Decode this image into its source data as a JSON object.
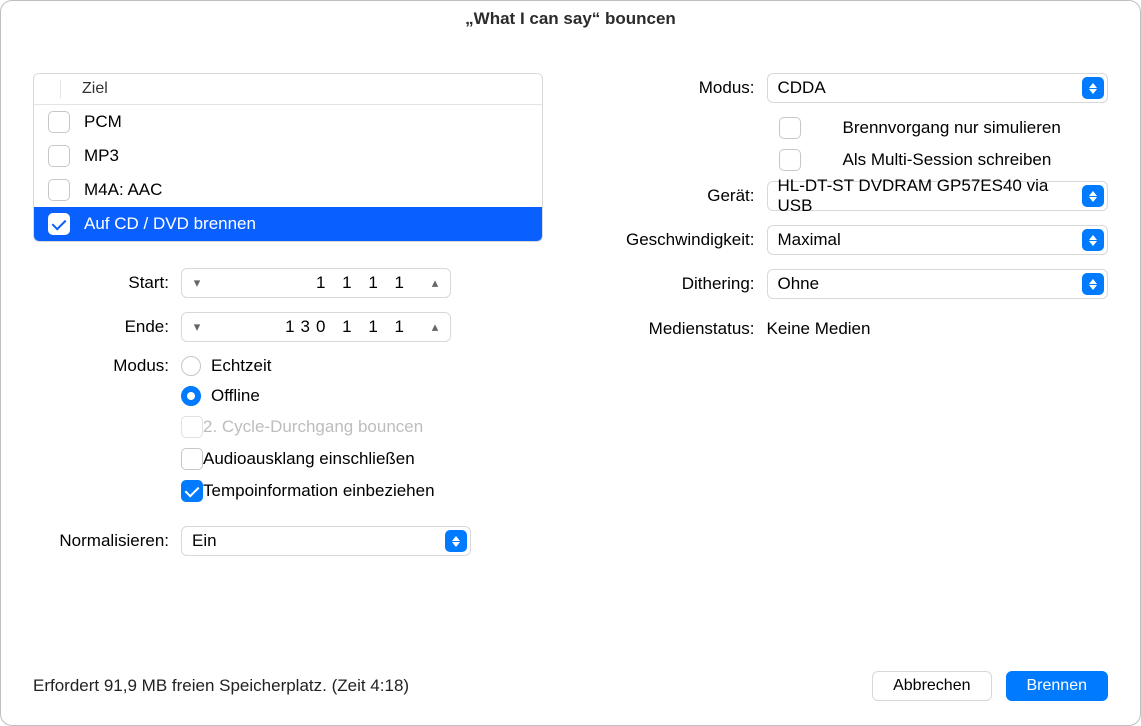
{
  "title": "„What I can say“ bouncen",
  "targets": {
    "header": "Ziel",
    "items": [
      {
        "label": "PCM",
        "checked": false,
        "selected": false
      },
      {
        "label": "MP3",
        "checked": false,
        "selected": false
      },
      {
        "label": "M4A: AAC",
        "checked": false,
        "selected": false
      },
      {
        "label": "Auf CD / DVD brennen",
        "checked": true,
        "selected": true
      }
    ]
  },
  "range": {
    "start_label": "Start:",
    "start_value": "1 1 1   1",
    "end_label": "Ende:",
    "end_value": "130 1 1   1"
  },
  "left_modus": {
    "label": "Modus:",
    "options": {
      "realtime": "Echtzeit",
      "offline": "Offline"
    },
    "selected": "offline",
    "second_cycle": {
      "label": "2. Cycle-Durchgang bouncen",
      "checked": false,
      "disabled": true
    },
    "audio_tail": {
      "label": "Audioausklang einschließen",
      "checked": false
    },
    "tempo_info": {
      "label": "Tempoinformation einbeziehen",
      "checked": true
    }
  },
  "normalize": {
    "label": "Normalisieren:",
    "value": "Ein"
  },
  "right": {
    "modus": {
      "label": "Modus:",
      "value": "CDDA"
    },
    "simulate": {
      "label": "Brennvorgang nur simulieren",
      "checked": false
    },
    "multi": {
      "label": "Als Multi-Session schreiben",
      "checked": false
    },
    "device": {
      "label": "Gerät:",
      "value": "HL-DT-ST DVDRAM GP57ES40 via USB"
    },
    "speed": {
      "label": "Geschwindigkeit:",
      "value": "Maximal"
    },
    "dither": {
      "label": "Dithering:",
      "value": "Ohne"
    },
    "media": {
      "label": "Medienstatus:",
      "value": "Keine Medien"
    }
  },
  "footer": {
    "space": "Erfordert 91,9 MB freien Speicherplatz. (Zeit 4:18)",
    "cancel": "Abbrechen",
    "burn": "Brennen"
  }
}
